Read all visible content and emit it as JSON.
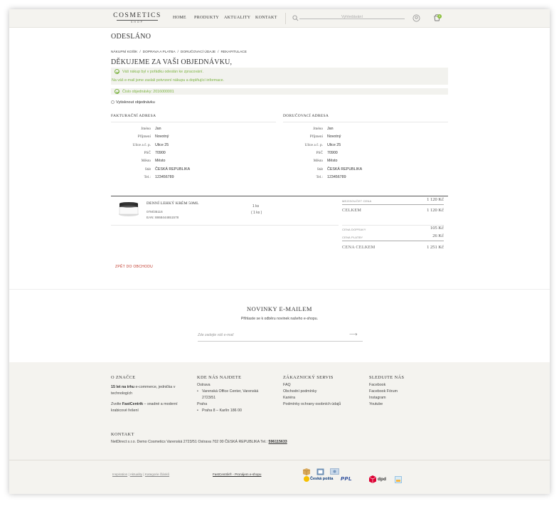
{
  "header": {
    "logo_main": "COSMETICS",
    "logo_sub": "SHOP",
    "nav": [
      "HOME",
      "PRODUKTY",
      "AKTUALITY",
      "KONTAKT"
    ],
    "search_placeholder": "Vyhledávání",
    "cart_count": "0"
  },
  "page": {
    "title": "ODESLÁNO",
    "breadcrumbs": [
      "NÁKUPNÍ KOŠÍK",
      "/",
      "DOPRAVA A PLATBA",
      "/",
      "DORUČOVACÍ ÚDAJE",
      "/",
      "REKAPITULACE"
    ],
    "thanks": "DĚKUJEME ZA VAŠI OBJEDNÁVKU,",
    "msg1": "Váš nákup byl v pořádku odeslán ke zpracování.",
    "msg2": "Na váš e-mail jsme zaslali potvrzení nákupu a doplňující informace.",
    "order_number": "Číslo objednávky: 2016000001",
    "print": "Vytisknout objednávku"
  },
  "billing": {
    "heading": "FAKTURAČNÍ ADRESA",
    "rows": [
      {
        "label": "Jméno",
        "value": "Jan"
      },
      {
        "label": "Příjmení",
        "value": "Novotný"
      },
      {
        "label": "Ulice a č. p.",
        "value": "Ulice 25"
      },
      {
        "label": "PSČ",
        "value": "70900"
      },
      {
        "label": "Město",
        "value": "Město"
      },
      {
        "label": "Stát",
        "value": "ČESKÁ REPUBLIKA"
      },
      {
        "label": "Tel.:",
        "value": "123456789"
      }
    ]
  },
  "delivery": {
    "heading": "DORUČOVACÍ ADRESA",
    "rows": [
      {
        "label": "Jméno",
        "value": "Jan"
      },
      {
        "label": "Příjmení",
        "value": "Novotný"
      },
      {
        "label": "Ulice a č. p.",
        "value": "Ulice 25"
      },
      {
        "label": "PSČ",
        "value": "70900"
      },
      {
        "label": "Město",
        "value": "Město"
      },
      {
        "label": "Stát",
        "value": "ČESKÁ REPUBLIKA"
      },
      {
        "label": "Tel.:",
        "value": "123456789"
      }
    ]
  },
  "order": {
    "product_name": "DENNÍ LEHKÝ KRÉM 50ML",
    "code": "07M/35116",
    "ean": "EAN: 8868444651578",
    "qty": "1 ks",
    "qty2": "( 1 ks )",
    "items_price_label": "MEZISOUČET CENA",
    "items_price": "1 120 Kč",
    "total_label": "CELKEM",
    "total": "1 120 Kč",
    "shipping_label": "CENA DOPRAVY",
    "shipping": "105 Kč",
    "payment_label": "CENA PLATBY",
    "payment": "26 Kč",
    "grand_label": "CENA CELKEM",
    "grand": "1 251 Kč",
    "back": "ZPĚT DO OBCHODU"
  },
  "newsletter": {
    "title": "NOVINKY E-MAILEM",
    "subtitle": "Přihlaste se k odběru novinek našeho e-shopu.",
    "placeholder": "Zde zadejte váš e-mail"
  },
  "footer": {
    "col1": {
      "heading": "O ZNAČCE",
      "p1_bold": "15 let na trhu",
      "p1": " e-commerce, jednička v technologích",
      "p2a": "Zvolte ",
      "p2_bold": "FastCentrik",
      "p2b": " – snadné a moderní krabicové řešení"
    },
    "col2": {
      "heading": "KDE NÁS NAJDETE",
      "city1": "Ostrava",
      "addr1a": "Varenská Office Center, Varenská",
      "addr1b": "2723/51",
      "city2": "Praha",
      "addr2": "Praha 8 – Karlín 186 00"
    },
    "col3": {
      "heading": "ZÁKAZNICKÝ SERVIS",
      "links": [
        "FAQ",
        "Obchodní podmínky",
        "Kariéra",
        "Podmínky ochrany osobních údajů"
      ]
    },
    "col3_last": "Podmínky ochrany osobních údajů",
    "col4": {
      "heading": "SLEDUJTE NÁS",
      "links": [
        "Facebook",
        "Facebook Fórum",
        "Instagram",
        "Youtube"
      ]
    },
    "contact_heading": "KONTAKT",
    "contact_text": "NetDirect s.r.o. Demo Cosmetics Varenská 2723/51 Ostrava 702 00 ČESKÁ REPUBLIKA Tel.:",
    "contact_phone": "596115633",
    "bottom_links": [
      "Inspiration",
      "|",
      "Aktuality",
      "|",
      "Kategorie článků"
    ],
    "powered": "FastCentrik® - Pronájem e-shopu",
    "shipping_logos": [
      "Česká pošta",
      "PPL",
      "dpd"
    ]
  }
}
